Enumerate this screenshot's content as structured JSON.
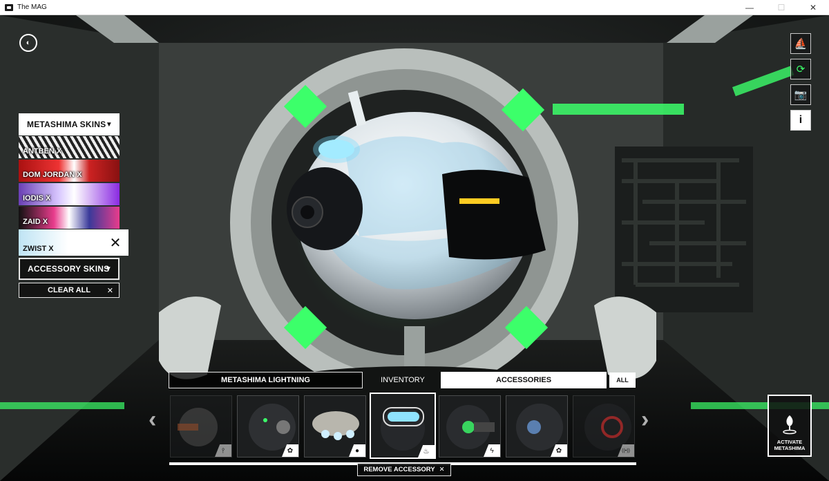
{
  "window": {
    "title": "The MAG",
    "minimize": "—",
    "maximize": "☐",
    "close": "✕"
  },
  "logo": {
    "glyph": "◐"
  },
  "toolbar": {
    "items": [
      {
        "icon": "ship-icon",
        "glyph": "⛵"
      },
      {
        "icon": "rotate-icon",
        "glyph": "⟳"
      },
      {
        "icon": "camera-icon",
        "glyph": "📷"
      },
      {
        "icon": "info-icon",
        "glyph": "i"
      }
    ]
  },
  "skins_panel": {
    "dropdown_label": "METASHIMA SKINS",
    "caret": "▼",
    "skins": [
      {
        "label": "ANTBEN X",
        "active": false
      },
      {
        "label": "DOM JORDAN X",
        "active": false
      },
      {
        "label": "IODIS X",
        "active": false
      },
      {
        "label": "ZAID X",
        "active": false
      },
      {
        "label": "ZWIST X",
        "active": true
      }
    ],
    "close_glyph": "✕",
    "accessory_dropdown_label": "ACCESSORY SKINS",
    "clear_all_label": "CLEAR ALL",
    "clear_all_x": "✕"
  },
  "tabs": {
    "lightning": "METASHIMA LIGHTNING",
    "inventory": "INVENTORY",
    "accessories": "ACCESSORIES",
    "all": "ALL"
  },
  "carousel": {
    "prev": "‹",
    "next": "›",
    "items": [
      {
        "badge": "⫯",
        "selected": false
      },
      {
        "badge": "✿",
        "selected": false
      },
      {
        "badge": "●",
        "selected": false
      },
      {
        "badge": "♨",
        "selected": true
      },
      {
        "badge": "ϟ",
        "selected": false
      },
      {
        "badge": "✿",
        "selected": false
      },
      {
        "badge": "((•))",
        "selected": false
      }
    ]
  },
  "remove_accessory": {
    "label": "REMOVE ACCESSORY",
    "x": "✕"
  },
  "activate": {
    "line1": "ACTIVATE",
    "line2": "METASHIMA"
  },
  "colors": {
    "accent_green": "#3cff6a",
    "panel_white": "#ffffff",
    "helmet_blue": "#7fc6e8"
  }
}
